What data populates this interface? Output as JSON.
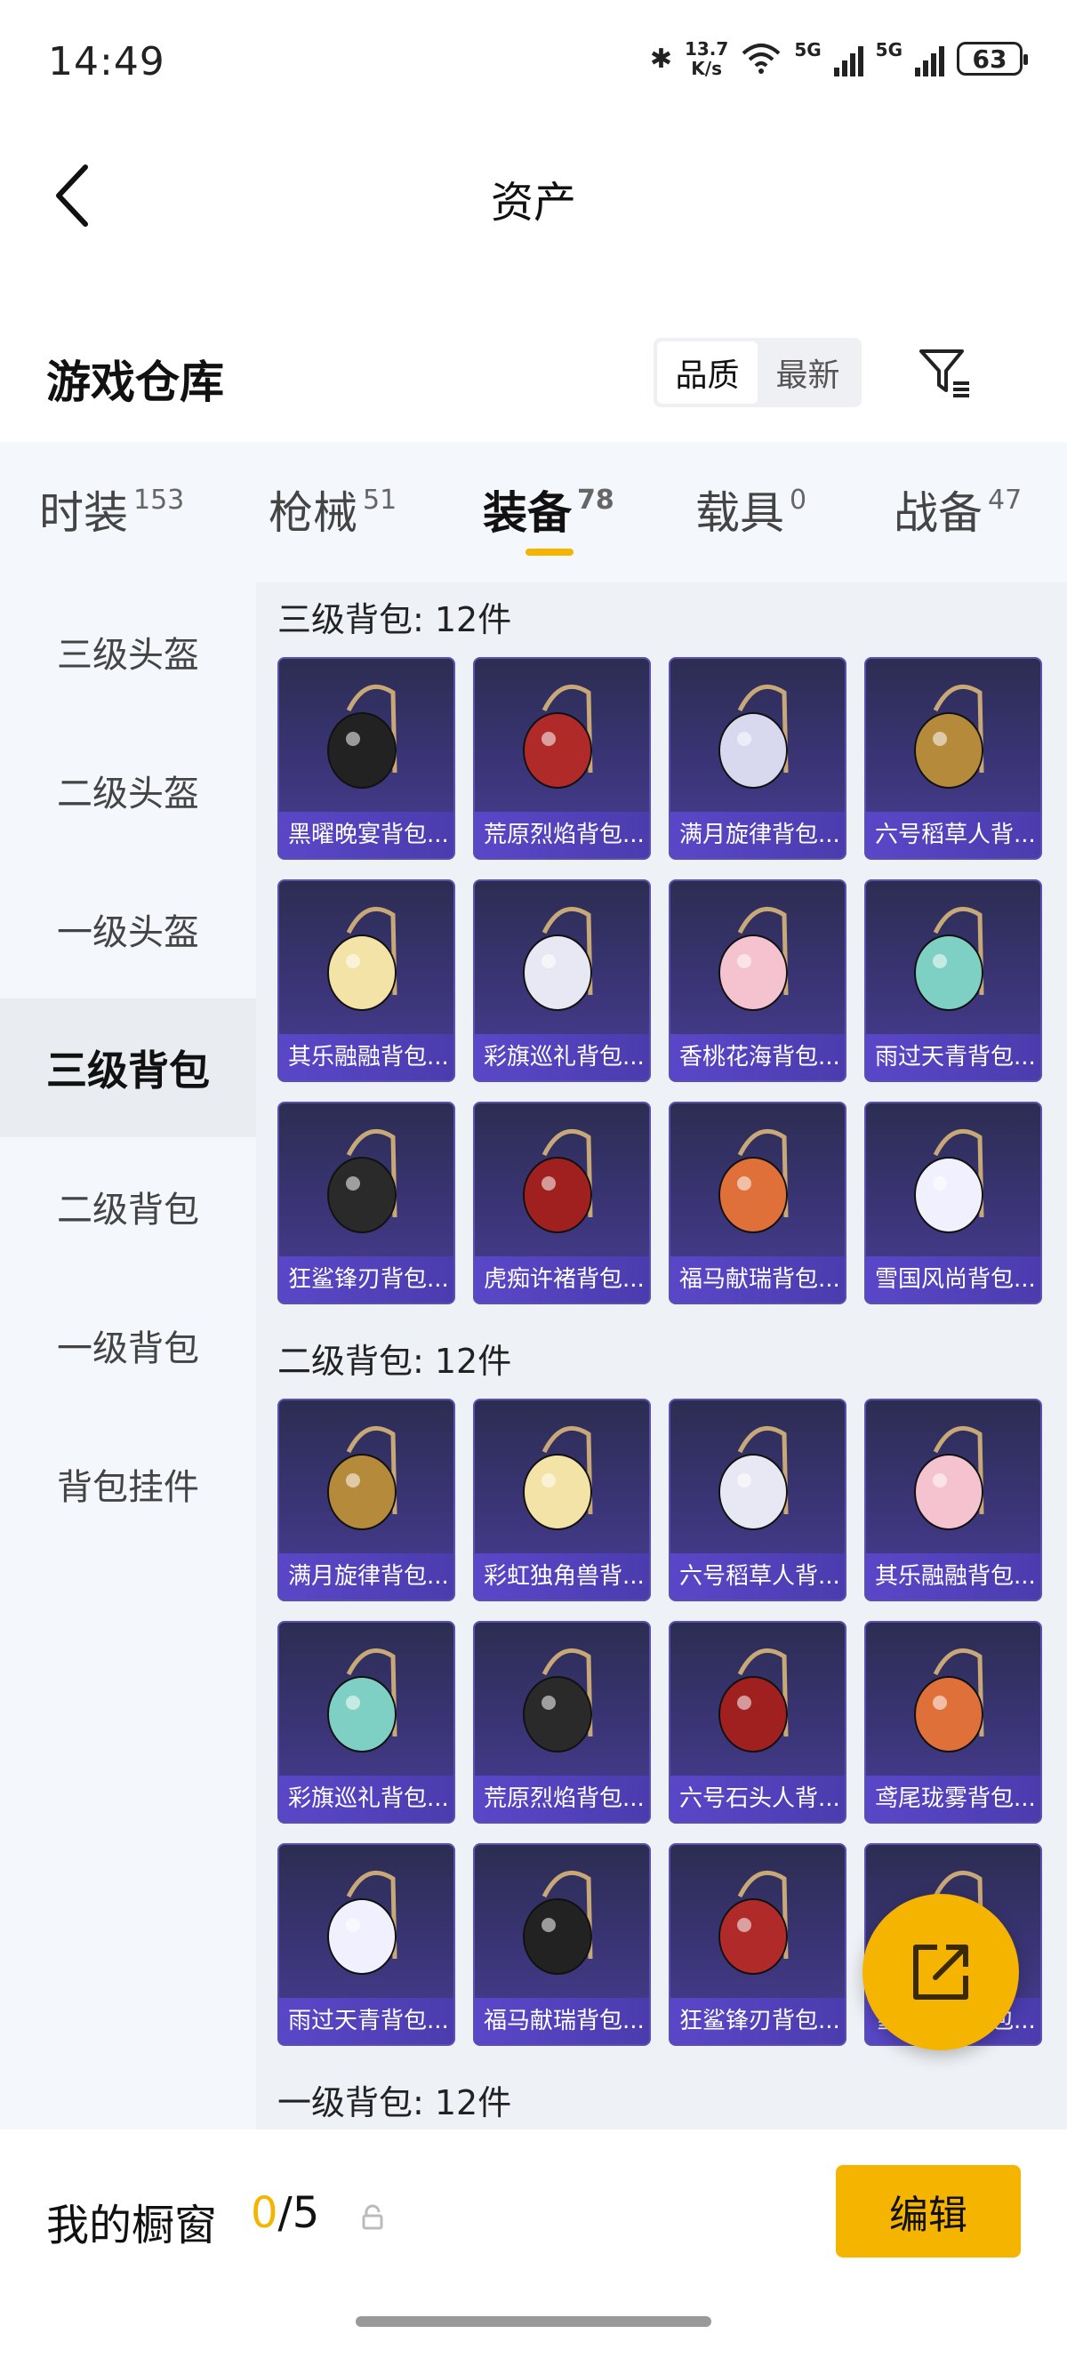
{
  "status_bar": {
    "time": "14:49",
    "net_speed_value": "13.7",
    "net_speed_unit": "K/s",
    "net_type_1": "5G",
    "net_type_2": "5G",
    "battery": "63"
  },
  "header": {
    "title": "资产"
  },
  "section": {
    "title": "游戏仓库",
    "sort_options": [
      "品质",
      "最新"
    ],
    "active_sort": "品质"
  },
  "tabs": [
    {
      "label": "时装",
      "count": "153"
    },
    {
      "label": "枪械",
      "count": "51"
    },
    {
      "label": "装备",
      "count": "78"
    },
    {
      "label": "载具",
      "count": "0"
    },
    {
      "label": "战备",
      "count": "47"
    }
  ],
  "active_tab": "装备",
  "sidebar": {
    "items": [
      "三级头盔",
      "二级头盔",
      "一级头盔",
      "三级背包",
      "二级背包",
      "一级背包",
      "背包挂件"
    ],
    "active": "三级背包"
  },
  "groups": [
    {
      "title": "三级背包: 12件",
      "items": [
        "黑曜晚宴背包...",
        "荒原烈焰背包...",
        "满月旋律背包...",
        "六号稻草人背...",
        "其乐融融背包...",
        "彩旗巡礼背包...",
        "香桃花海背包...",
        "雨过天青背包...",
        "狂鲨锋刃背包...",
        "虎痴许褚背包...",
        "福马献瑞背包...",
        "雪国风尚背包..."
      ]
    },
    {
      "title": "二级背包: 12件",
      "items": [
        "满月旋律背包...",
        "彩虹独角兽背...",
        "六号稻草人背...",
        "其乐融融背包...",
        "彩旗巡礼背包...",
        "荒原烈焰背包...",
        "六号石头人背...",
        "鸢尾珑雾背包...",
        "雨过天青背包...",
        "福马献瑞背包...",
        "狂鲨锋刃背包...",
        "雪国风尚背包..."
      ]
    },
    {
      "title": "一级背包: 12件",
      "items": []
    }
  ],
  "bottom_bar": {
    "label": "我的橱窗",
    "count_current": "0",
    "count_total": "/5",
    "edit_label": "编辑"
  },
  "colors": {
    "accent": "#f5b400",
    "card_bg": "#3b3578",
    "label_bg": "#5a47c8"
  }
}
